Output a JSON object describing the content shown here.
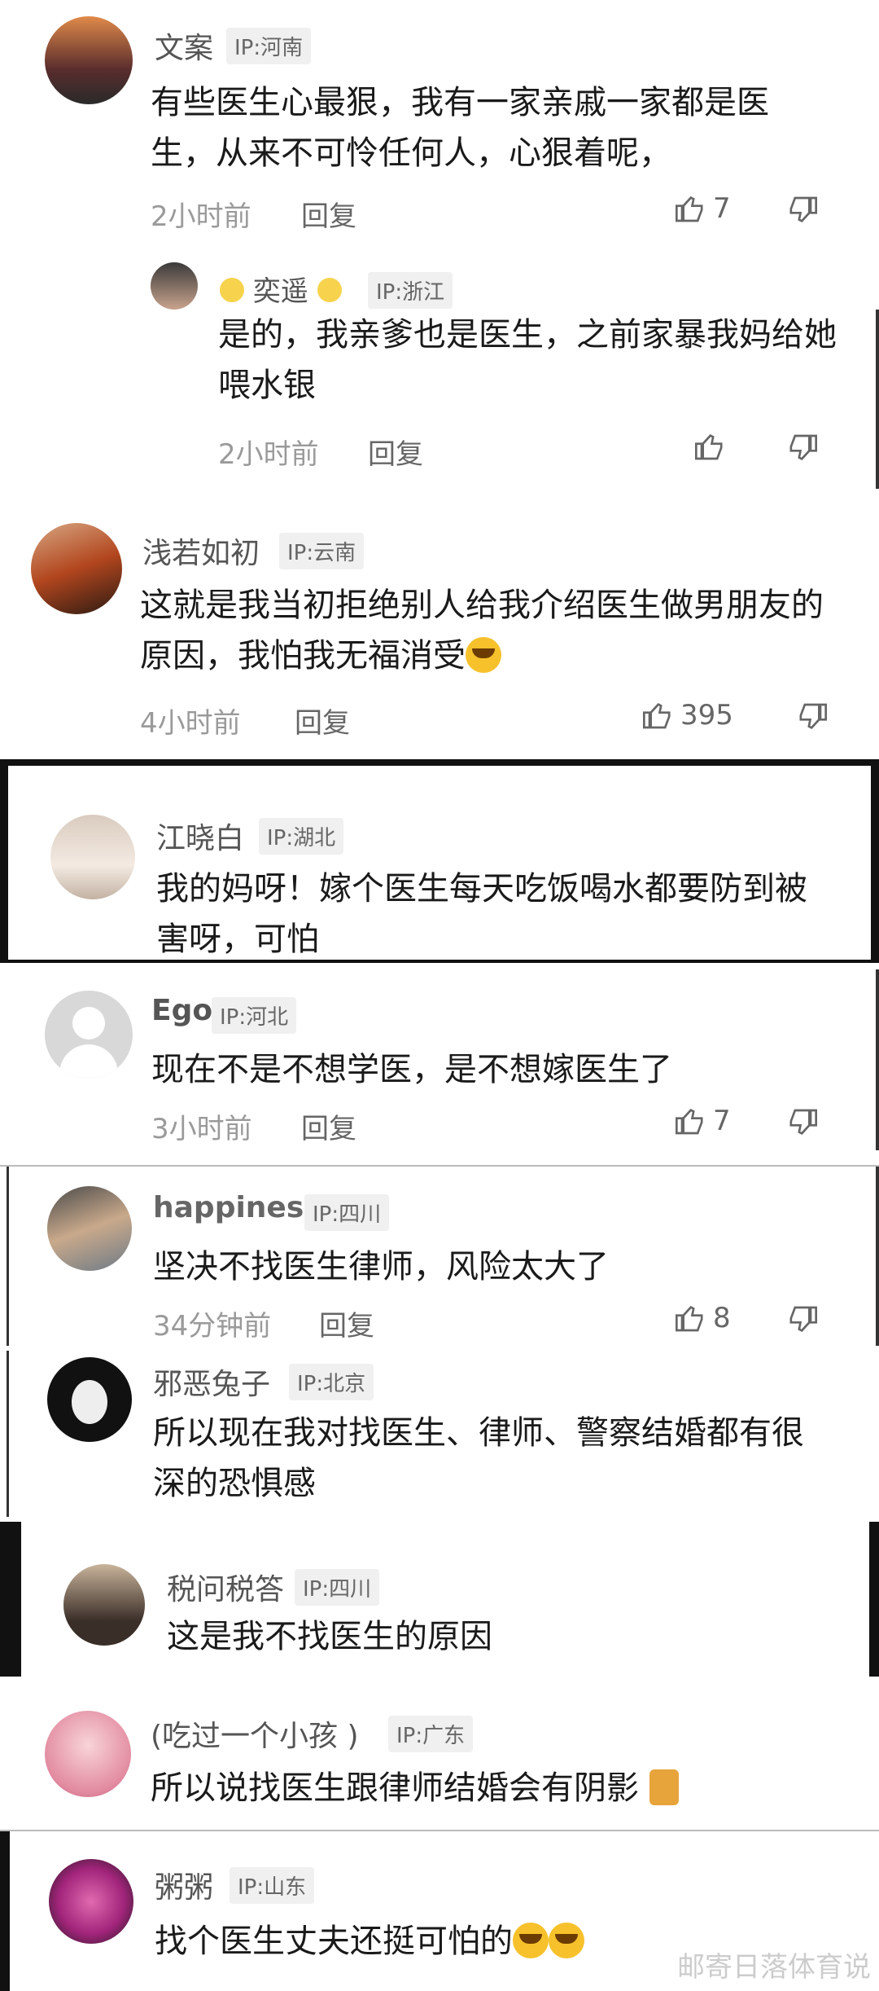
{
  "comments": [
    {
      "name": "文案",
      "ip": "IP:河南",
      "text": "有些医生心最狠，我有一家亲戚一家都是医生，从来不可怜任何人，心狠着呢，",
      "time": "2小时前",
      "reply": "回复",
      "likes": "7"
    },
    {
      "name": "奕遥",
      "ip": "IP:浙江",
      "text": "是的，我亲爹也是医生，之前家暴我妈给她喂水银",
      "time": "2小时前",
      "reply": "回复",
      "likes": ""
    },
    {
      "name": "浅若如初",
      "ip": "IP:云南",
      "text": "这就是我当初拒绝别人给我介绍医生做男朋友的原因，我怕我无福消受",
      "time": "4小时前",
      "reply": "回复",
      "likes": "395"
    },
    {
      "name": "江晓白",
      "ip": "IP:湖北",
      "text": "我的妈呀！嫁个医生每天吃饭喝水都要防到被害呀，可怕"
    },
    {
      "name": "Ego",
      "ip": "IP:河北",
      "text": "现在不是不想学医，是不想嫁医生了",
      "time": "3小时前",
      "reply": "回复",
      "likes": "7"
    },
    {
      "name": "happiness",
      "ip": "IP:四川",
      "text": "坚决不找医生律师，风险太大了",
      "time": "34分钟前",
      "reply": "回复",
      "likes": "8"
    },
    {
      "name": "邪恶兔子",
      "ip": "IP:北京",
      "text": "所以现在我对找医生、律师、警察结婚都有很深的恐惧感"
    },
    {
      "name": "税问税答",
      "ip": "IP:四川",
      "text": "这是我不找医生的原因"
    },
    {
      "name": "(吃过一个小孩 )",
      "ip": "IP:广东",
      "text": "所以说找医生跟律师结婚会有阴影"
    },
    {
      "name": "粥粥",
      "ip": "IP:山东",
      "text": "找个医生丈夫还挺可怕的"
    }
  ],
  "watermark": "邮寄日落体育说",
  "icons": {
    "like": "thumbs-up-icon",
    "dislike": "thumbs-down-icon"
  }
}
